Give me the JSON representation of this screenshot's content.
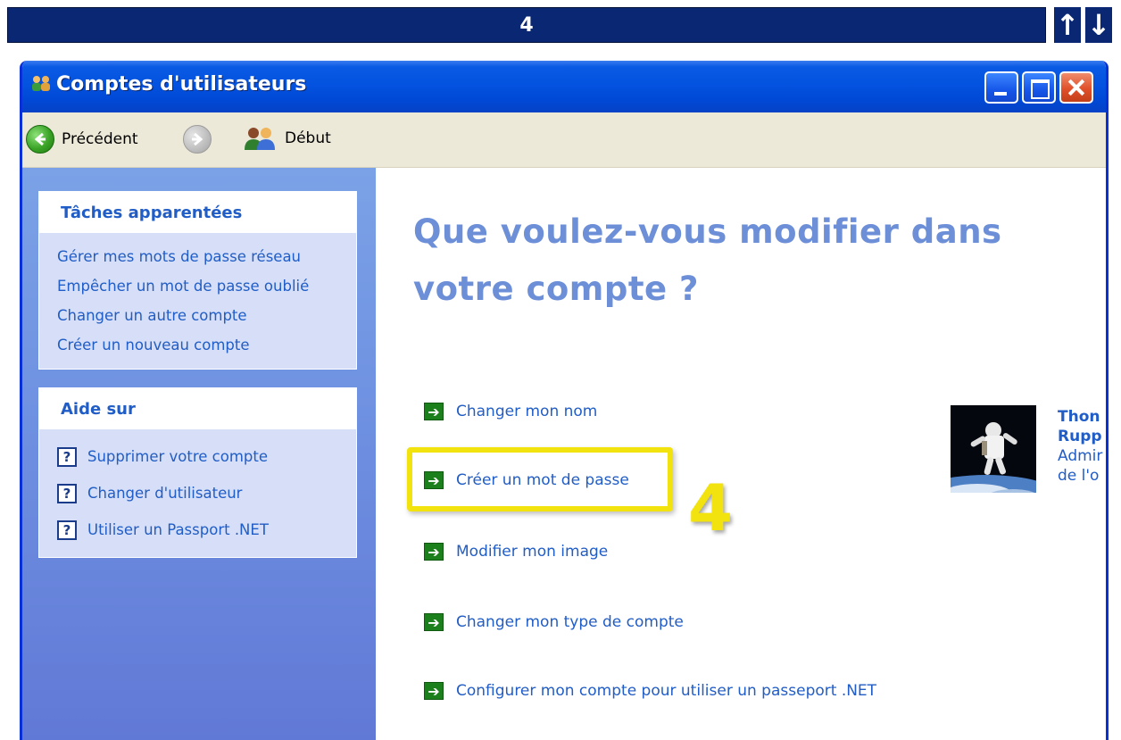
{
  "step_banner": {
    "label": "4"
  },
  "nav": {
    "up_glyph": "↑",
    "down_glyph": "↓"
  },
  "window": {
    "title": "Comptes d'utilisateurs",
    "title_icon": "users-icon"
  },
  "toolbar": {
    "back_label": "Précédent",
    "forward_icon": "forward-arrow-icon",
    "home_label": "Début"
  },
  "sidebar": {
    "related_tasks": {
      "title": "Tâches apparentées",
      "items": [
        "Gérer mes mots de passe réseau",
        "Empêcher un mot de passe oublié",
        "Changer un autre compte",
        "Créer un nouveau compte"
      ]
    },
    "help": {
      "title": "Aide sur",
      "items": [
        "Supprimer votre compte",
        "Changer d'utilisateur",
        "Utiliser un Passport .NET"
      ]
    }
  },
  "main": {
    "heading_line1": "Que voulez-vous modifier dans",
    "heading_line2": "votre compte ?",
    "actions": [
      "Changer mon nom",
      "Créer un mot de passe",
      "Modifier mon image",
      "Changer mon type de compte",
      "Configurer mon compte pour utiliser un passeport .NET"
    ],
    "step_marker": "4",
    "user": {
      "name_line1": "Thon",
      "name_line2": "Rupp",
      "role_line1": "Admir",
      "role_line2": "de l'o"
    }
  },
  "colors": {
    "link": "#215dc6",
    "heading": "#6c8fd8",
    "highlight": "#f2e20e",
    "titlebar": "#0453e0",
    "banner": "#0a2773"
  }
}
